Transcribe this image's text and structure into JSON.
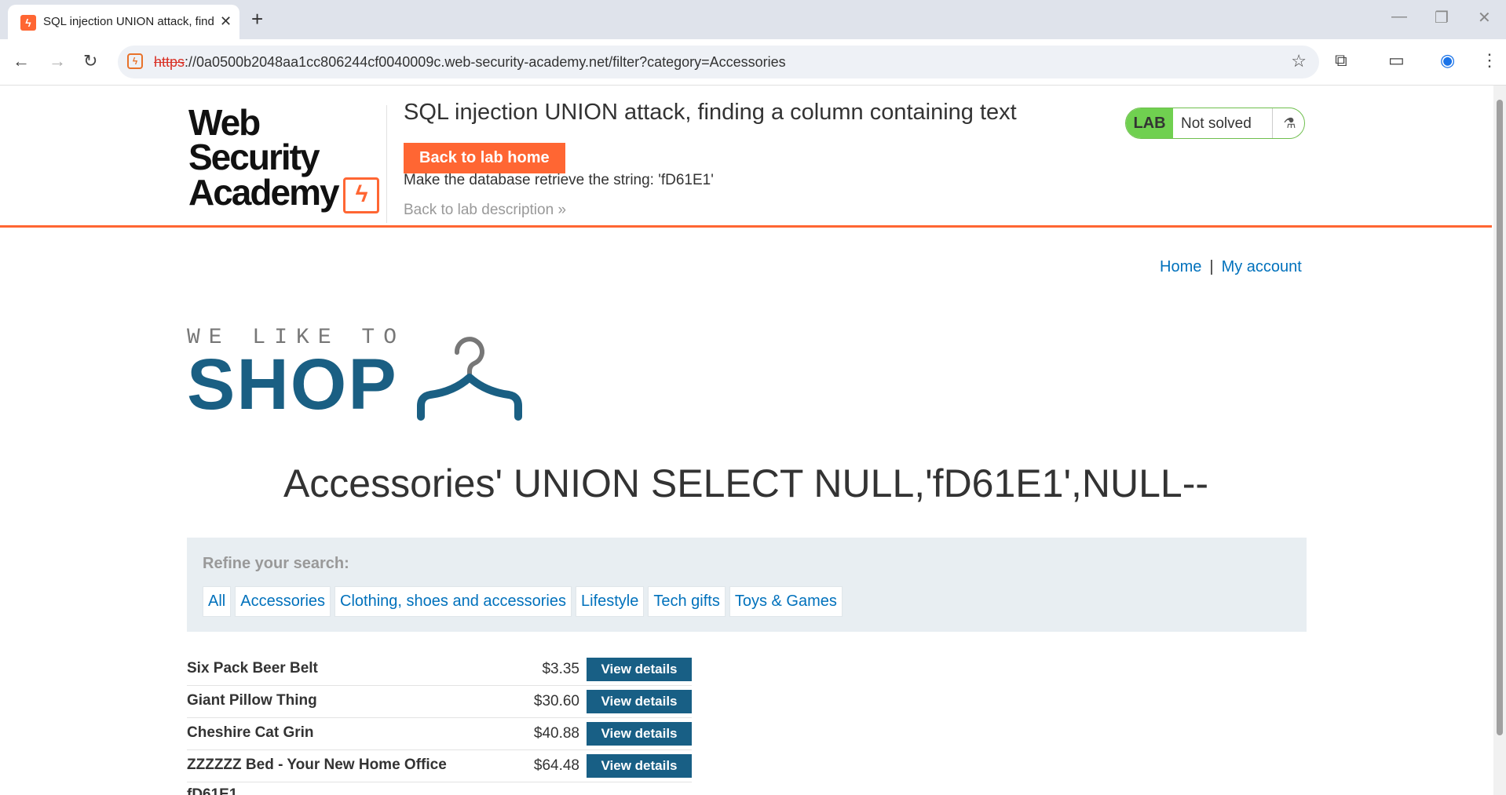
{
  "browser": {
    "tab_title": "SQL injection UNION attack, finding a column containing text",
    "url_scheme": "https",
    "url_rest": "://0a0500b2048aa1cc806244cf0040009c.web-security-academy.net/filter?category=Accessories"
  },
  "lab": {
    "logo_line1": "Web Security",
    "logo_line2": "Academy",
    "title": "SQL injection UNION attack, finding a column containing text",
    "back_home": "Back to lab home",
    "instructions": "Make the database retrieve the string: 'fD61E1'",
    "back_description": "Back to lab description »",
    "status_badge": "LAB",
    "status_text": "Not solved"
  },
  "nav": {
    "home": "Home",
    "separator": "|",
    "account": "My account"
  },
  "shop_logo": {
    "tagline": "WE LIKE TO",
    "word": "SHOP"
  },
  "category_title": "Accessories' UNION SELECT NULL,'fD61E1',NULL--",
  "filters": {
    "label": "Refine your search:",
    "items": [
      "All",
      "Accessories",
      "Clothing, shoes and accessories",
      "Lifestyle",
      "Tech gifts",
      "Toys & Games"
    ]
  },
  "products": [
    {
      "name": "Six Pack Beer Belt",
      "price": "$3.35",
      "button": "View details"
    },
    {
      "name": "Giant Pillow Thing",
      "price": "$30.60",
      "button": "View details"
    },
    {
      "name": "Cheshire Cat Grin",
      "price": "$40.88",
      "button": "View details"
    },
    {
      "name": "ZZZZZZ Bed - Your New Home Office",
      "price": "$64.48",
      "button": "View details"
    }
  ],
  "extra_row": "fD61E1",
  "colors": {
    "accent": "#ff6633",
    "link": "#0071bc",
    "shop_blue": "#1a5f83",
    "lab_green": "#70d050"
  }
}
